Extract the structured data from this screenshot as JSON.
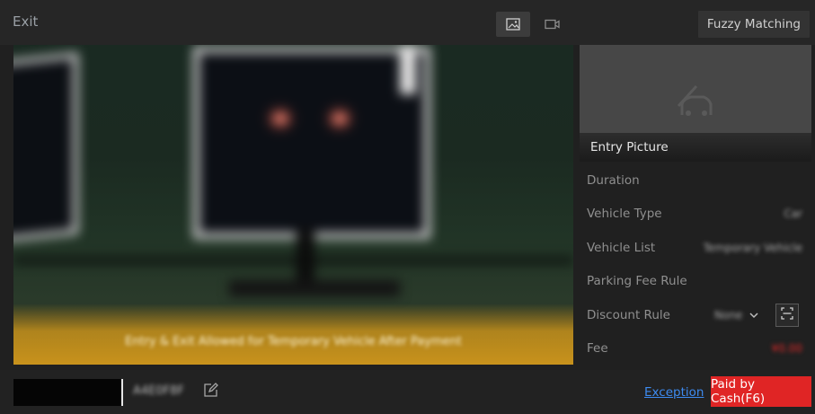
{
  "header": {
    "title": "Exit",
    "fuzzy_matching_label": "Fuzzy Matching",
    "view_modes": [
      {
        "icon": "image-icon",
        "active": true
      },
      {
        "icon": "video-icon",
        "active": false
      }
    ]
  },
  "camera": {
    "caption": "Entry & Exit Allowed for Temporary Vehicle After Payment"
  },
  "entry_panel": {
    "label": "Entry Picture",
    "icon": "vehicle-placeholder-icon"
  },
  "info": {
    "rows": [
      {
        "label": "Duration",
        "value": ""
      },
      {
        "label": "Vehicle Type",
        "value": "Car"
      },
      {
        "label": "Vehicle List",
        "value": "Temporary Vehicle"
      },
      {
        "label": "Parking Fee Rule",
        "value": ""
      },
      {
        "label": "Discount Rule",
        "value": "None"
      },
      {
        "label": "Fee",
        "value": "¥0.00"
      }
    ]
  },
  "bottom": {
    "plate_number": "A4E0F8F",
    "exception_label": "Exception",
    "paid_label": "Paid by Cash(F6)"
  },
  "colors": {
    "accent_red": "#e02525",
    "link_blue": "#3d8bf0",
    "caption_gold": "#c8921c"
  }
}
